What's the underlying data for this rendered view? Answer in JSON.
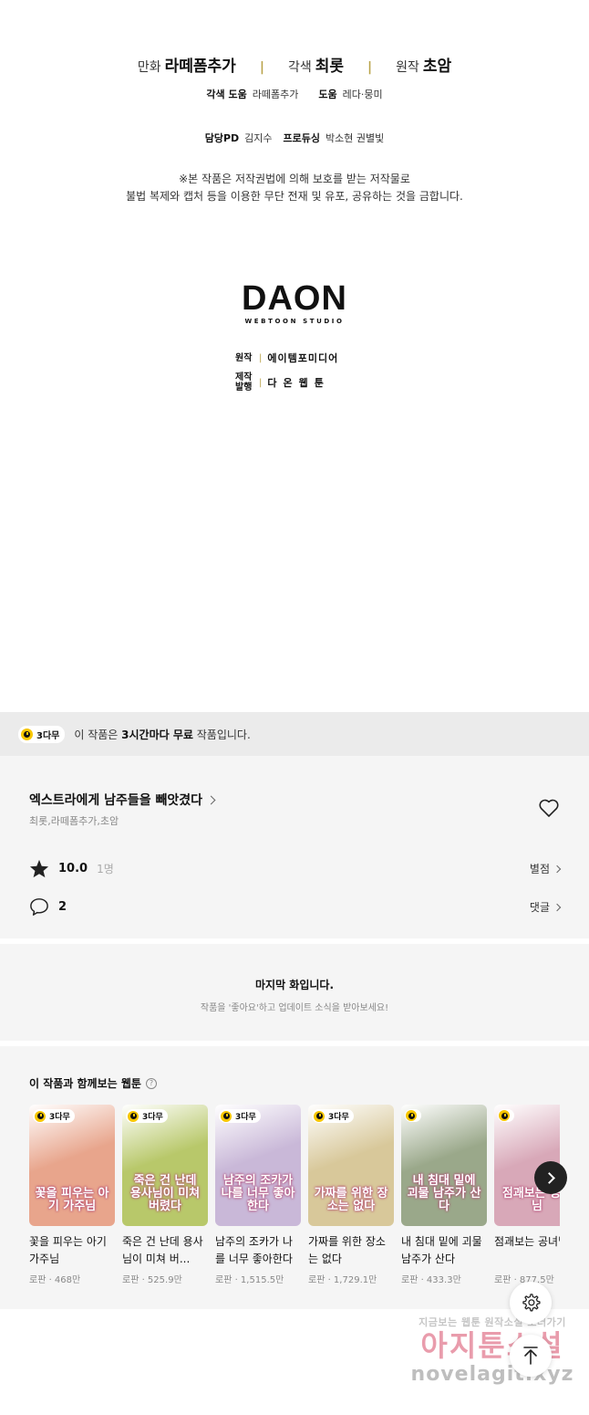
{
  "credits": {
    "manhwa_label": "만화",
    "manhwa_name": "라떼폼추가",
    "adapt_label": "각색",
    "adapt_name": "최롯",
    "original_label": "원작",
    "original_name": "초암",
    "adapt_help_label": "각색 도움",
    "adapt_help_name": "라떼폼추가",
    "help_label": "도움",
    "help_name": "레다·뭉미",
    "pd_label": "담당PD",
    "pd_name": "김지수",
    "producing_label": "프로듀싱",
    "producing_name": "박소현 권별빛",
    "notice_line1": "※본 작품은 저작권법에 의해 보호를 받는 저작물로",
    "notice_line2": "불법 복제와 캡처 등을 이용한 무단 전재 및 유포, 공유하는 것을 금합니다."
  },
  "studio": {
    "logo": "DAON",
    "logo_sub": "WEBTOON STUDIO",
    "original_label": "원작",
    "original_value": "에이템포미디어",
    "production_label1": "제작",
    "production_label2": "발행",
    "production_value": "다온웹툰"
  },
  "free_banner": {
    "badge": "3다무",
    "text_pre": "이 작품은 ",
    "text_bold": "3시간마다 무료",
    "text_post": " 작품입니다."
  },
  "work": {
    "title": "엑스트라에게 남주들을 빼앗겼다",
    "authors": "최롯,라떼폼추가,초암",
    "rating": "10.0",
    "rating_count": "1명",
    "rating_link": "별점",
    "comments": "2",
    "comments_link": "댓글"
  },
  "last_episode": {
    "title": "마지막 화입니다.",
    "subtitle": "작품을 '좋아요'하고 업데이트 소식을 받아보세요!"
  },
  "recommend": {
    "title": "이 작품과 함께보는 웹툰",
    "help_icon": "?",
    "items": [
      {
        "title": "꽃을 피우는 아기 가주님",
        "meta": "로판 · 468만",
        "badge": "3다무",
        "logo": "꽃을 피우는 아기 가주님",
        "bg": "#e8a58c"
      },
      {
        "title": "죽은 건 난데 용사님이 미쳐 버...",
        "meta": "로판 · 525.9만",
        "badge": "3다무",
        "logo": "죽은 건 난데 용사님이 미쳐버렸다",
        "bg": "#b8c86a"
      },
      {
        "title": "남주의 조카가 나를 너무 좋아한다",
        "meta": "로판 · 1,515.5만",
        "badge": "3다무",
        "logo": "남주의 조카가 나를 너무 좋아한다",
        "bg": "#c9b8d8"
      },
      {
        "title": "가짜를 위한 장소는 없다",
        "meta": "로판 · 1,729.1만",
        "badge": "3다무",
        "logo": "가짜를 위한 장소는 없다",
        "bg": "#d8c89a"
      },
      {
        "title": "내 침대 밑에 괴물 남주가 산다",
        "meta": "로판 · 433.3만",
        "badge": "",
        "logo": "내 침대 밑에 괴물 남주가 산다",
        "bg": "#9aa88a"
      },
      {
        "title": "점괘보는 공녀님",
        "meta": "로판 · 877.5만",
        "badge": "",
        "logo": "점괘보는 공녀님",
        "bg": "#d8a8b8"
      }
    ]
  },
  "watermark": {
    "line1": "지금보는 웹툰 원작소설 보러가기",
    "line2": "아지툰소설",
    "line3": "novelagit.xyz"
  },
  "colors": {
    "accent_gold": "#b9a34a",
    "badge_yellow": "#f7c600",
    "watermark_pink": "#d84d6a"
  }
}
